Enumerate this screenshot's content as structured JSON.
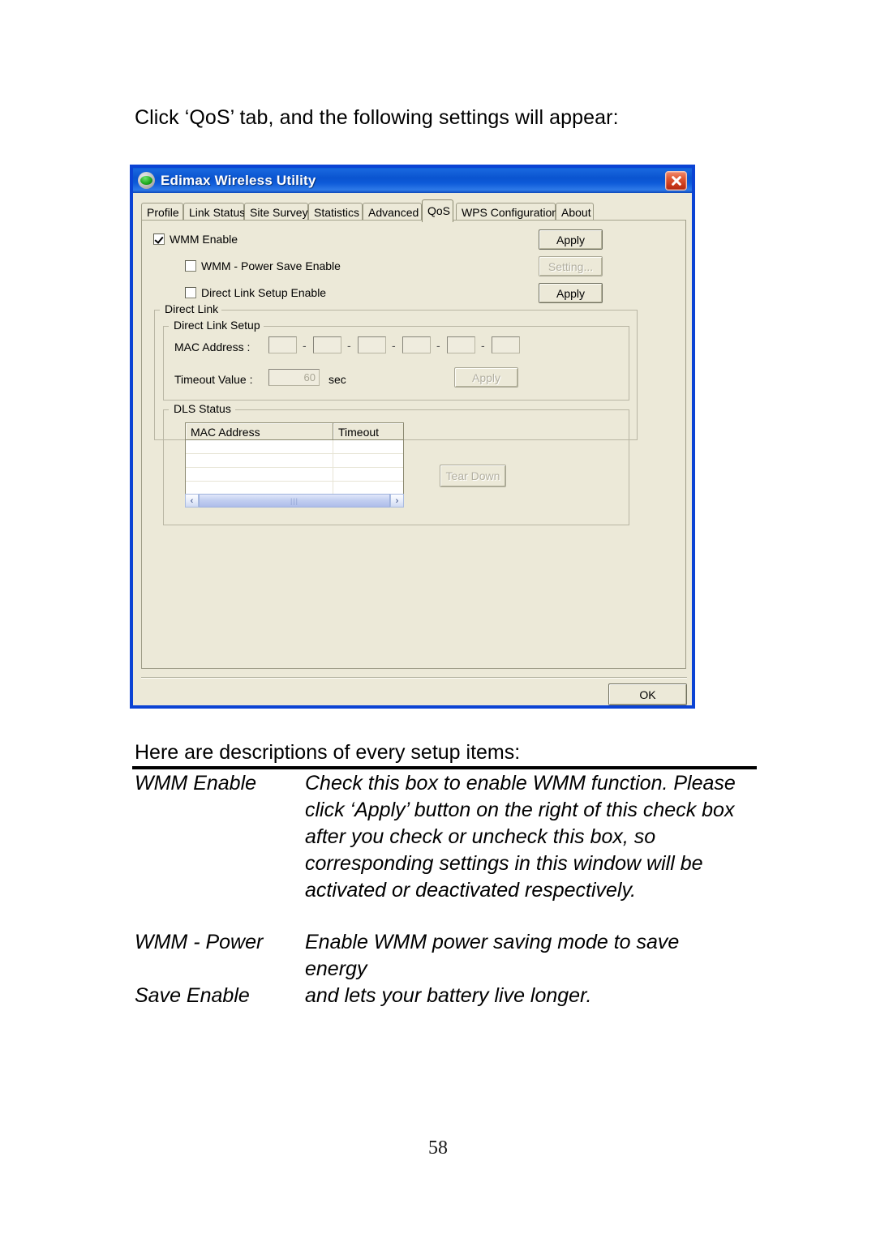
{
  "document": {
    "intro_text": "Click ‘QoS’ tab, and the following settings will appear:",
    "descriptions_heading": "Here are descriptions of every setup items:",
    "page_number": "58",
    "description_items": [
      {
        "term": "WMM Enable",
        "definition_lines": [
          "Check this box to enable WMM function. Please",
          "click ‘Apply’ button on the right of this check box",
          "after you check or uncheck this box, so",
          "corresponding settings in this window will be",
          "activated or deactivated respectively."
        ]
      },
      {
        "term": "WMM - Power",
        "term_line2": "Save Enable",
        "definition_lines": [
          "Enable WMM power saving mode to save",
          "energy",
          "and lets your battery live longer."
        ]
      }
    ]
  },
  "window": {
    "title": "Edimax Wireless Utility",
    "icon": "globe-icon",
    "close_label": "close-icon",
    "accent_color": "#0B43D4",
    "face_color": "#ECE9D8",
    "tabs": [
      {
        "label": "Profile",
        "active": false
      },
      {
        "label": "Link Status",
        "active": false
      },
      {
        "label": "Site Survey",
        "active": false
      },
      {
        "label": "Statistics",
        "active": false
      },
      {
        "label": "Advanced",
        "active": false
      },
      {
        "label": "QoS",
        "active": true
      },
      {
        "label": "WPS Configuration",
        "active": false
      },
      {
        "label": "About",
        "active": false
      }
    ],
    "qos": {
      "wmm_enable": {
        "label": "WMM Enable",
        "checked": true
      },
      "wmm_enable_apply": {
        "label": "Apply",
        "disabled": false
      },
      "wmm_power_save": {
        "label": "WMM - Power Save Enable",
        "checked": false
      },
      "wmm_power_save_setting": {
        "label": "Setting...",
        "disabled": true
      },
      "direct_link_setup": {
        "label": "Direct Link Setup Enable",
        "checked": false
      },
      "direct_link_apply": {
        "label": "Apply",
        "disabled": false
      },
      "direct_link_group": "Direct Link",
      "direct_link_setup_group": "Direct Link Setup",
      "mac_address_label": "MAC Address :",
      "mac_separator": "-",
      "mac_octets": [
        "",
        "",
        "",
        "",
        "",
        ""
      ],
      "timeout_label": "Timeout Value :",
      "timeout_value": "60",
      "timeout_unit": "sec",
      "timeout_apply": {
        "label": "Apply",
        "disabled": true
      },
      "dls_status_group": "DLS Status",
      "dls_columns": [
        "MAC Address",
        "Timeout"
      ],
      "dls_rows": [],
      "dls_empty_row_count": 4,
      "tear_down": {
        "label": "Tear Down",
        "disabled": true
      },
      "scroll_left": "‹",
      "scroll_right": "›"
    },
    "ok_button": {
      "label": "OK"
    }
  }
}
